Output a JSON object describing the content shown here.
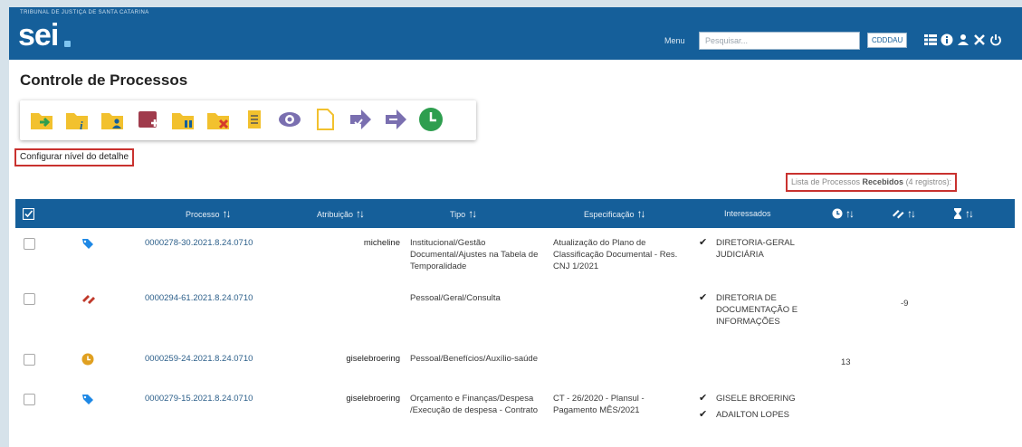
{
  "header": {
    "org_name": "TRIBUNAL DE JUSTIÇA DE SANTA CATARINA",
    "logo_text": "sei",
    "menu_label": "Menu",
    "search_placeholder": "Pesquisar...",
    "unit_label": "CDDDAU",
    "icons": [
      "search-icon",
      "grid-icon",
      "info-icon",
      "user-icon",
      "tools-icon",
      "power-icon"
    ]
  },
  "page": {
    "title": "Controle de Processos",
    "detail_link": "Configurar nível do detalhe"
  },
  "toolbar": {
    "buttons": [
      "send-process-icon",
      "note-icon",
      "assign-icon",
      "new-icon",
      "suspend-icon",
      "close-icon",
      "annotation-icon",
      "view-icon",
      "document-icon",
      "forward-icon",
      "return-icon",
      "clock-icon"
    ]
  },
  "list": {
    "caption_prefix": "Lista de Processos ",
    "caption_bold": "Recebidos",
    "caption_count": " (4 registros):"
  },
  "table": {
    "headers": {
      "processo": "Processo",
      "atribuicao": "Atribuição",
      "tipo": "Tipo",
      "especificacao": "Especificação",
      "interessados": "Interessados"
    },
    "rows": [
      {
        "status_icon": "tag-icon",
        "processo": "0000278-30.2021.8.24.0710",
        "atribuicao": "micheline",
        "tipo": "Institucional/Gestão Documental/Ajustes na Tabela de Temporalidade",
        "especificacao": "Atualização do Plano de Classificação Documental - Res. CNJ 1/2021",
        "interessados": [
          "DIRETORIA-GERAL JUDICIÁRIA"
        ],
        "col_a": "",
        "col_b": "",
        "col_c": ""
      },
      {
        "status_icon": "transfer-icon",
        "processo": "0000294-61.2021.8.24.0710",
        "atribuicao": "",
        "tipo": "Pessoal/Geral/Consulta",
        "especificacao": "",
        "interessados": [
          "DIRETORIA DE DOCUMENTAÇÃO E INFORMAÇÕES"
        ],
        "col_a": "",
        "col_b": "-9",
        "col_c": ""
      },
      {
        "status_icon": "deadline-icon",
        "processo": "0000259-24.2021.8.24.0710",
        "atribuicao": "giselebroering",
        "tipo": "Pessoal/Benefícios/Auxílio-saúde",
        "especificacao": "",
        "interessados": [],
        "col_a": "13",
        "col_b": "",
        "col_c": ""
      },
      {
        "status_icon": "tag-icon",
        "processo": "0000279-15.2021.8.24.0710",
        "atribuicao": "giselebroering",
        "tipo": "Orçamento e Finanças/Despesa /Execução de despesa - Contrato",
        "especificacao": "CT - 26/2020 - Plansul - Pagamento MÊS/2021",
        "interessados": [
          "GISELE BROERING",
          "ADAILTON LOPES"
        ],
        "col_a": "",
        "col_b": "",
        "col_c": ""
      }
    ]
  },
  "colors": {
    "header_blue": "#155f9a",
    "highlight_red": "#c9322f",
    "toolbar_yellow": "#f2c12e",
    "toolbar_green": "#2e9e4f",
    "toolbar_purple": "#7a6fb0",
    "tag_blue": "#1e88e5",
    "transfer_red": "#c0392b",
    "deadline_orange": "#e0a020"
  }
}
